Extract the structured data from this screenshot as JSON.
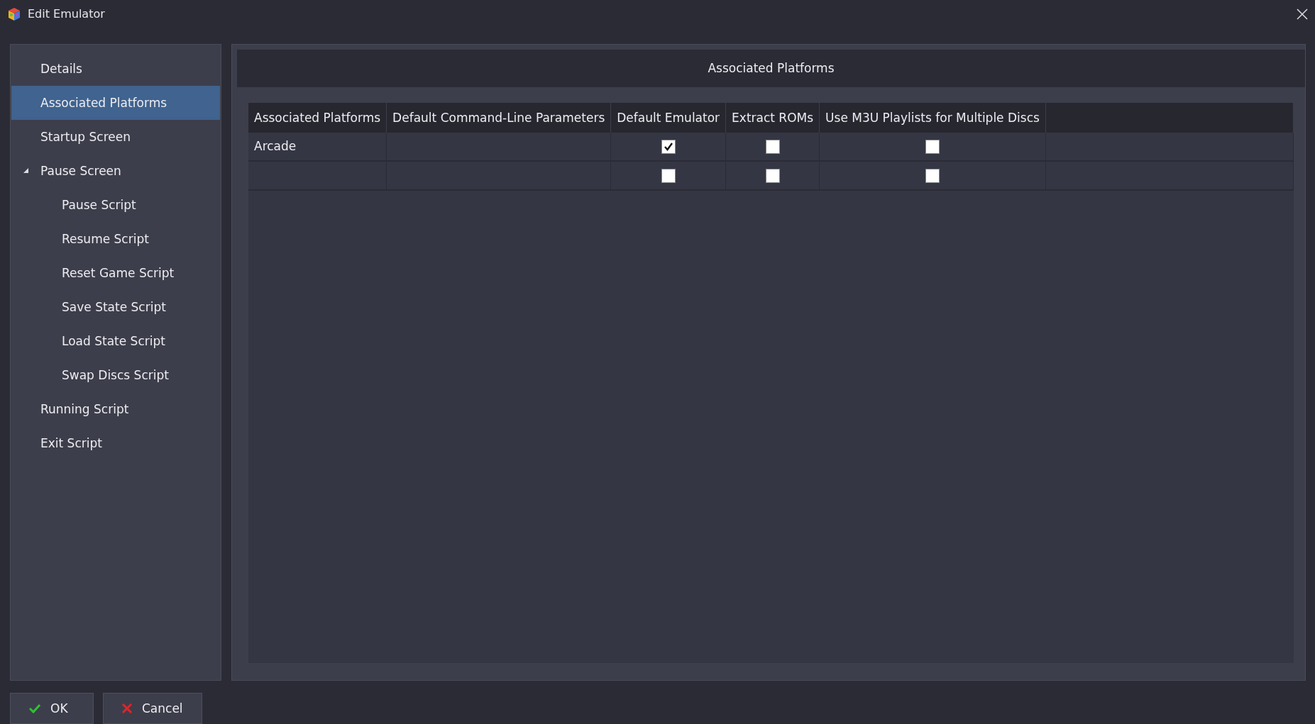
{
  "window": {
    "title": "Edit Emulator"
  },
  "sidebar": {
    "items": [
      {
        "label": "Details",
        "selected": false
      },
      {
        "label": "Associated Platforms",
        "selected": true
      },
      {
        "label": "Startup Screen",
        "selected": false
      },
      {
        "label": "Pause Screen",
        "selected": false,
        "expanded": true,
        "children": [
          {
            "label": "Pause Script",
            "selected": false
          },
          {
            "label": "Resume Script",
            "selected": false
          },
          {
            "label": "Reset Game Script",
            "selected": false
          },
          {
            "label": "Save State Script",
            "selected": false
          },
          {
            "label": "Load State Script",
            "selected": false
          },
          {
            "label": "Swap Discs Script",
            "selected": false
          }
        ]
      },
      {
        "label": "Running Script",
        "selected": false
      },
      {
        "label": "Exit Script",
        "selected": false
      }
    ]
  },
  "panel": {
    "title": "Associated Platforms"
  },
  "table": {
    "columns": [
      "Associated Platforms",
      "Default Command-Line Parameters",
      "Default Emulator",
      "Extract ROMs",
      "Use M3U Playlists for Multiple Discs"
    ],
    "rows": [
      {
        "platform": "Arcade",
        "default_emulator": true,
        "extract_roms": false,
        "use_m3u": false
      },
      {
        "platform": "",
        "default_emulator": false,
        "extract_roms": false,
        "use_m3u": false
      }
    ]
  },
  "buttons": [
    {
      "kind": "ok",
      "label": "OK"
    },
    {
      "kind": "cancel",
      "label": "Cancel"
    }
  ]
}
